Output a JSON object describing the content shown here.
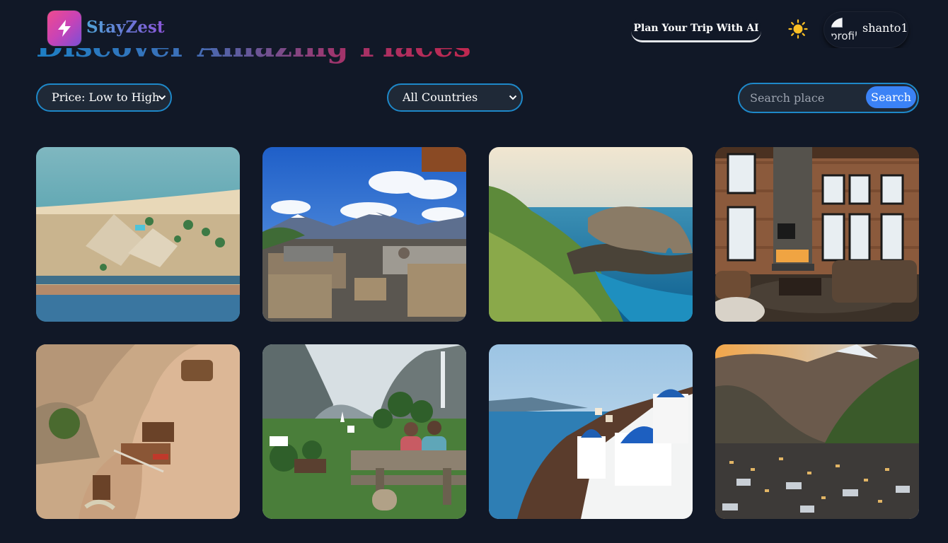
{
  "header": {
    "brand": "StayZest",
    "ai_button_label": "Plan Your Trip With AI",
    "theme_icon": "sun-icon",
    "user": {
      "avatar_alt": "profile",
      "username": "shanto1"
    }
  },
  "hero": {
    "title": "Discover Amazing Places"
  },
  "filters": {
    "price_sort": {
      "selected": "Price: Low to High"
    },
    "country": {
      "selected": "All Countries"
    },
    "search": {
      "placeholder": "Search place",
      "button_label": "Search"
    }
  },
  "places": [
    {
      "image": "aerial beach resort"
    },
    {
      "image": "mountain terrace lounge"
    },
    {
      "image": "coastal arch cliffs"
    },
    {
      "image": "loft living room with fireplace"
    },
    {
      "image": "cave hotel in rock"
    },
    {
      "image": "alpine valley with waterfall and bench"
    },
    {
      "image": "white and blue domed church by the sea"
    },
    {
      "image": "mountain village at dusk"
    }
  ],
  "colors": {
    "background": "#111827",
    "accent": "#1e88c9",
    "button": "#3b82f6"
  }
}
